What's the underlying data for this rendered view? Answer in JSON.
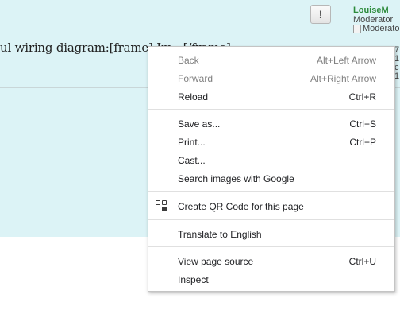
{
  "page": {
    "post_text": "ul wiring diagram:[frame] Im   [/frame]",
    "report_button_label": "!",
    "user": {
      "name": "LouiseM",
      "role": "Moderator",
      "role_image_alt": "Moderator"
    },
    "side_digits": [
      "7",
      "1",
      "c",
      "1"
    ]
  },
  "context_menu": {
    "items": [
      {
        "label": "Back",
        "shortcut": "Alt+Left Arrow",
        "enabled": false
      },
      {
        "label": "Forward",
        "shortcut": "Alt+Right Arrow",
        "enabled": false
      },
      {
        "label": "Reload",
        "shortcut": "Ctrl+R",
        "enabled": true
      },
      {
        "label": "Save as...",
        "shortcut": "Ctrl+S",
        "enabled": true
      },
      {
        "label": "Print...",
        "shortcut": "Ctrl+P",
        "enabled": true
      },
      {
        "label": "Cast...",
        "shortcut": "",
        "enabled": true
      },
      {
        "label": "Search images with Google",
        "shortcut": "",
        "enabled": true
      },
      {
        "label": "Create QR Code for this page",
        "shortcut": "",
        "enabled": true,
        "icon": "qr-code-icon"
      },
      {
        "label": "Translate to English",
        "shortcut": "",
        "enabled": true
      },
      {
        "label": "View page source",
        "shortcut": "Ctrl+U",
        "enabled": true
      },
      {
        "label": "Inspect",
        "shortcut": "",
        "enabled": true
      }
    ]
  },
  "colors": {
    "page_background": "#dcf3f6",
    "username": "#2c8b3b",
    "disabled_text": "#808080"
  }
}
